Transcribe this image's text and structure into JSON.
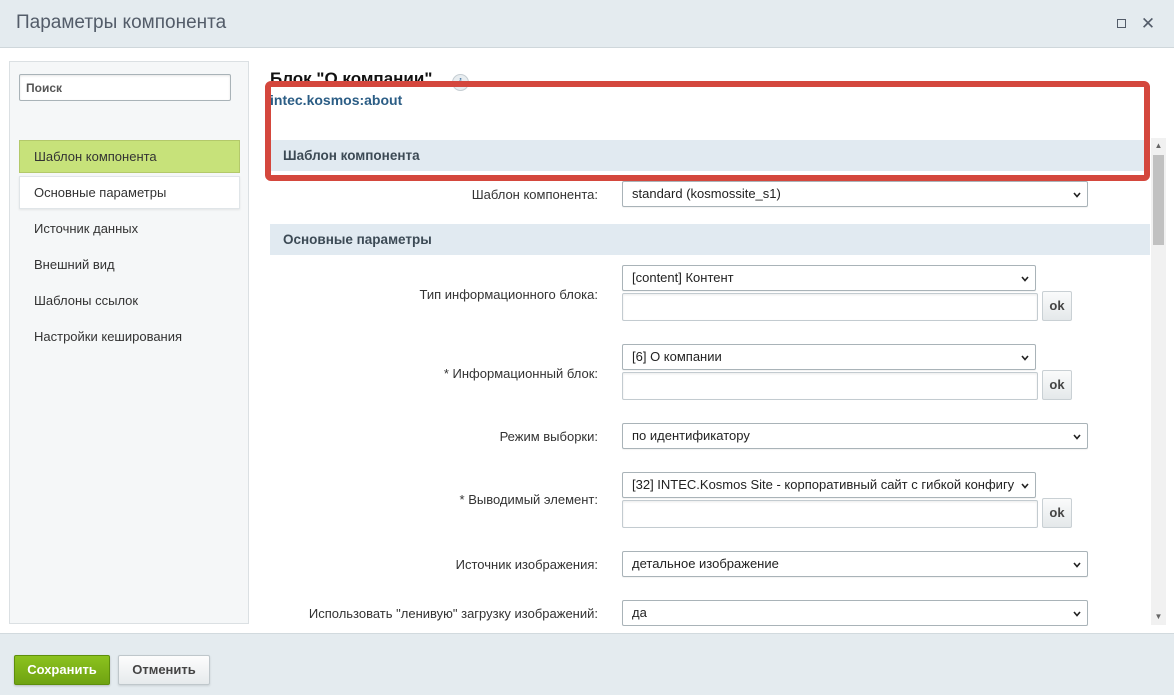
{
  "window": {
    "title": "Параметры компонента"
  },
  "sidebar": {
    "search_placeholder": "Поиск",
    "items": [
      {
        "label": "Шаблон компонента"
      },
      {
        "label": "Основные параметры"
      },
      {
        "label": "Источник данных"
      },
      {
        "label": "Внешний вид"
      },
      {
        "label": "Шаблоны ссылок"
      },
      {
        "label": "Настройки кеширования"
      }
    ]
  },
  "component": {
    "title": "Блок \"О компании\"",
    "code": "intec.kosmos:about",
    "info_glyph": "i"
  },
  "sections": {
    "template": {
      "heading": "Шаблон компонента",
      "field_label": "Шаблон компонента:",
      "field_value": "standard (kosmossite_s1)"
    },
    "main": {
      "heading": "Основные параметры",
      "fields": [
        {
          "label": "Тип информационного блока:",
          "value": "[content] Контент",
          "ok": "ok"
        },
        {
          "label": "* Информационный блок:",
          "value": "[6] О компании",
          "ok": "ok"
        },
        {
          "label": "Режим выборки:",
          "value": "по идентификатору"
        },
        {
          "label": "* Выводимый элемент:",
          "value": "[32] INTEC.Kosmos Site - корпоративный сайт с гибкой конфигу",
          "ok": "ok"
        },
        {
          "label": "Источник изображения:",
          "value": "детальное изображение"
        },
        {
          "label": "Использовать \"ленивую\" загрузку изображений:",
          "value": "да"
        }
      ]
    }
  },
  "footer": {
    "save_label": "Сохранить",
    "cancel_label": "Отменить"
  },
  "colors": {
    "highlight_border": "#d4473d",
    "active_nav": "#c7e27a",
    "save_button": "#7ab317"
  }
}
